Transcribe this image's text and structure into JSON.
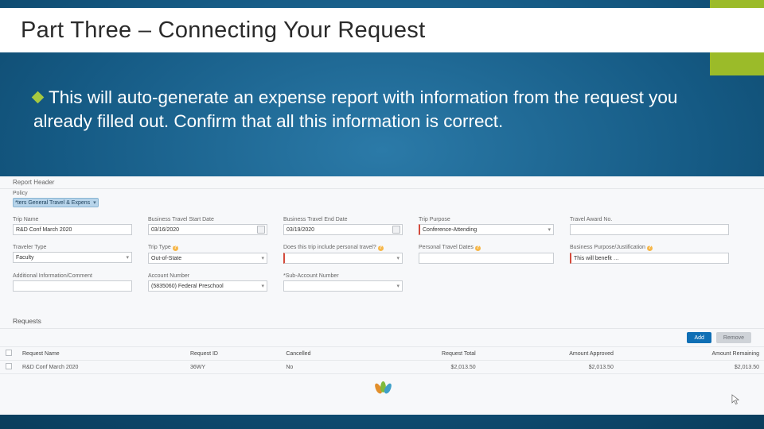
{
  "slide": {
    "title": "Part Three – Connecting Your Request",
    "bullet": "This will auto-generate an expense report with information from the request you already filled out. Confirm that all this information is correct."
  },
  "form": {
    "section_report_header": "Report Header",
    "policy_label": "Policy",
    "policy_value": "*ters General Travel & Expens",
    "fields": {
      "trip_name": {
        "label": "Trip Name",
        "value": "R&D Conf March 2020"
      },
      "bt_start": {
        "label": "Business Travel Start Date",
        "value": "03/16/2020"
      },
      "bt_end": {
        "label": "Business Travel End Date",
        "value": "03/19/2020"
      },
      "trip_purpose": {
        "label": "Trip Purpose",
        "value": "Conference-Attending"
      },
      "travel_award": {
        "label": "Travel Award No.",
        "value": ""
      },
      "traveler_type": {
        "label": "Traveler Type",
        "value": "Faculty"
      },
      "trip_type": {
        "label": "Trip Type",
        "value": "Out-of-State"
      },
      "personal_travel": {
        "label": "Does this trip include personal travel?",
        "value": ""
      },
      "personal_dates": {
        "label": "Personal Travel Dates",
        "value": ""
      },
      "biz_purpose": {
        "label": "Business Purpose/Justification",
        "value": "This will benefit …"
      },
      "addl_info": {
        "label": "Additional Information/Comment",
        "value": ""
      },
      "account_no": {
        "label": "Account Number",
        "value": "(5835060) Federal Preschool"
      },
      "sub_account": {
        "label": "*Sub-Account Number",
        "value": ""
      }
    },
    "section_requests": "Requests",
    "buttons": {
      "add": "Add",
      "remove": "Remove"
    },
    "table": {
      "headers": {
        "name": "Request Name",
        "id": "Request ID",
        "cancelled": "Cancelled",
        "total": "Request Total",
        "approved": "Amount Approved",
        "remaining": "Amount Remaining"
      },
      "row": {
        "name": "R&D Conf March 2020",
        "id": "36WY",
        "cancelled": "No",
        "total": "$2,013.50",
        "approved": "$2,013.50",
        "remaining": "$2,013.50"
      }
    }
  }
}
